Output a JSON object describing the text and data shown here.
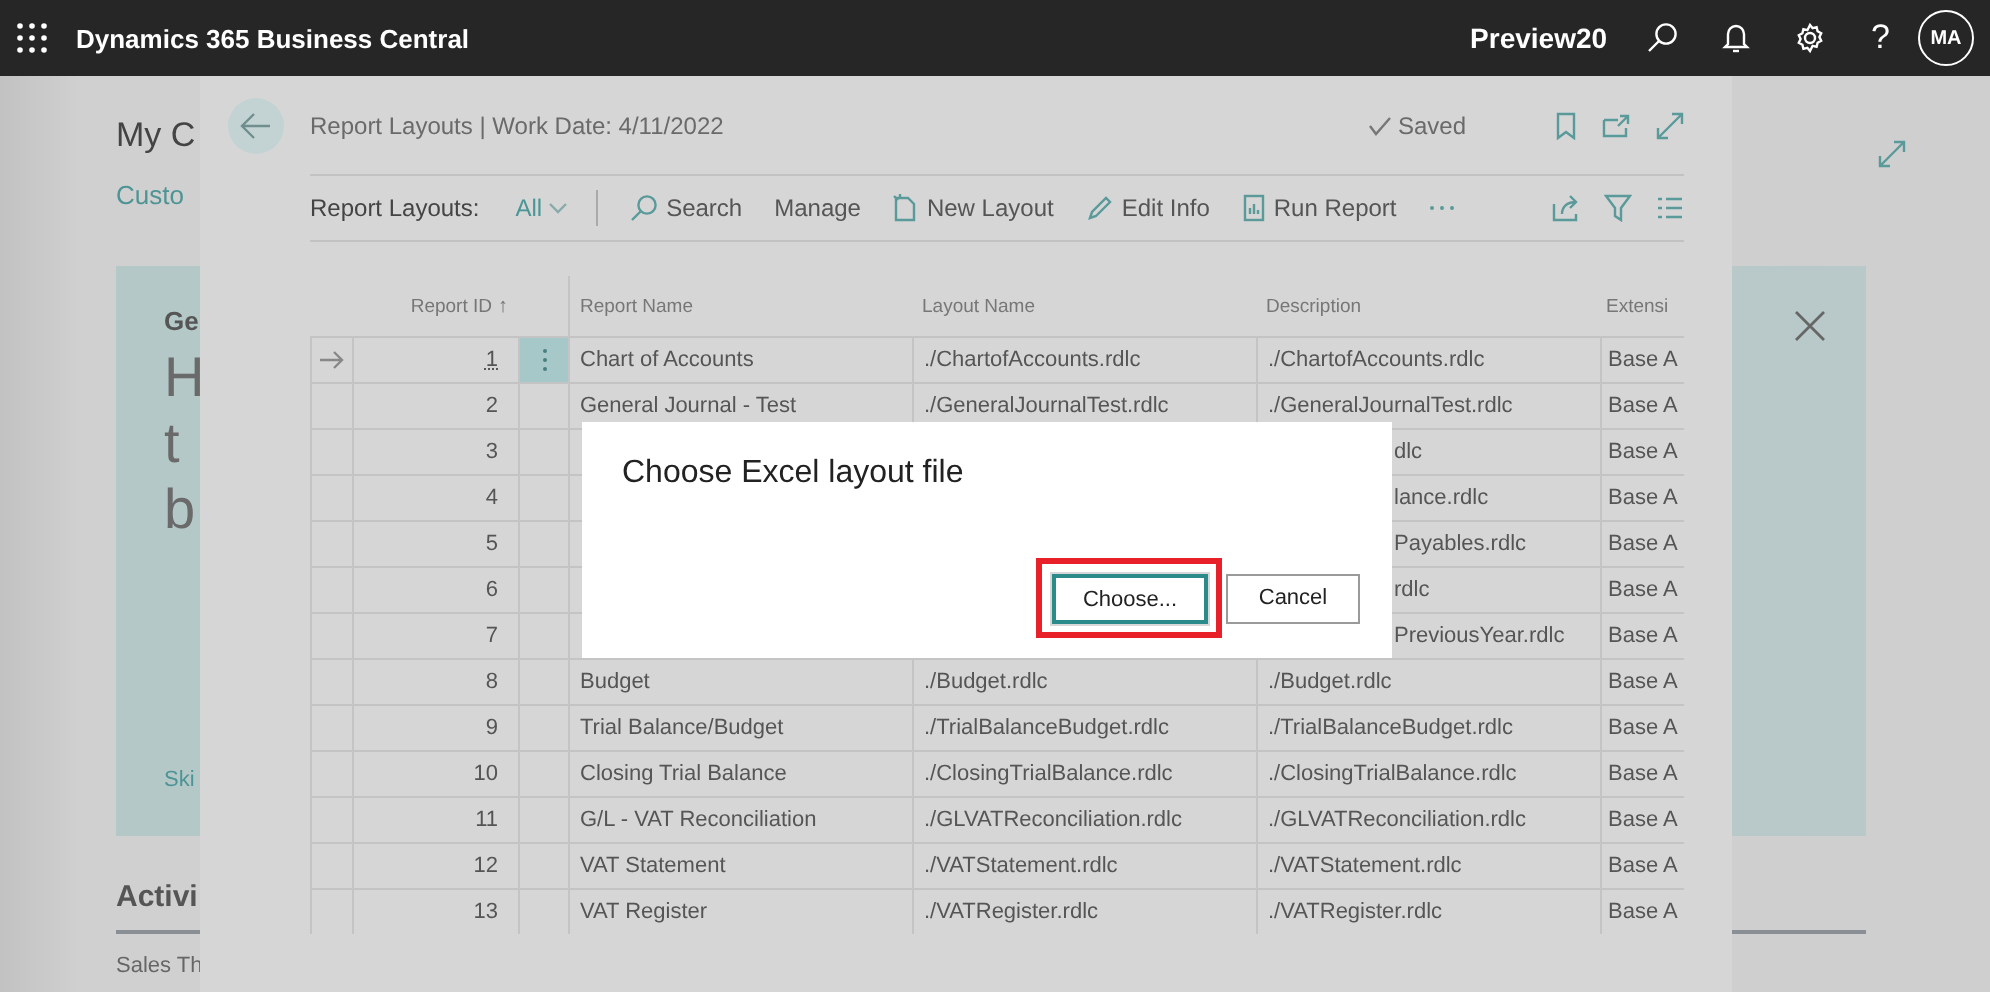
{
  "top_bar": {
    "app_title": "Dynamics 365 Business Central",
    "environment": "Preview20",
    "help": "?",
    "avatar": "MA"
  },
  "background_page": {
    "title": "My C",
    "link": "Custo",
    "card": {
      "heading": "Ge",
      "lines": [
        "H",
        "t",
        "b"
      ],
      "link": "Ski"
    },
    "section": "Activi",
    "subsection": "Sales Th"
  },
  "panel": {
    "title": "Report Layouts | Work Date: 4/11/2022",
    "status": "Saved",
    "filter_label": "Report Layouts:",
    "filter_value": "All",
    "actions": [
      {
        "label": "Search",
        "kind": "search"
      },
      {
        "label": "Manage",
        "kind": "plain"
      },
      {
        "label": "New Layout",
        "kind": "new"
      },
      {
        "label": "Edit Info",
        "kind": "edit"
      },
      {
        "label": "Run Report",
        "kind": "report"
      }
    ],
    "table": {
      "columns": [
        {
          "label": "Report ID",
          "sort_indicator": "↑"
        },
        {
          "label": "Report Name"
        },
        {
          "label": "Layout Name"
        },
        {
          "label": "Description"
        },
        {
          "label": "Extensi"
        }
      ],
      "rows": [
        {
          "id": "1",
          "name": "Chart of Accounts",
          "layout": "./ChartofAccounts.rdlc",
          "description": "./ChartofAccounts.rdlc",
          "covered": false,
          "extension": "Base A",
          "selected": true
        },
        {
          "id": "2",
          "name": "General Journal - Test",
          "layout": "./GeneralJournalTest.rdlc",
          "description": "./GeneralJournalTest.rdlc",
          "covered": false,
          "extension": "Base A",
          "selected": false
        },
        {
          "id": "3",
          "description": "dlc",
          "covered": true,
          "extension": "Base A",
          "selected": false
        },
        {
          "id": "4",
          "description": "lance.rdlc",
          "covered": true,
          "extension": "Base A",
          "selected": false
        },
        {
          "id": "5",
          "description": "Payables.rdlc",
          "covered": true,
          "extension": "Base A",
          "selected": false
        },
        {
          "id": "6",
          "description": "rdlc",
          "covered": true,
          "extension": "Base A",
          "selected": false
        },
        {
          "id": "7",
          "description": "PreviousYear.rdlc",
          "covered": true,
          "extension": "Base A",
          "selected": false
        },
        {
          "id": "8",
          "name": "Budget",
          "layout": "./Budget.rdlc",
          "description": "./Budget.rdlc",
          "covered": false,
          "extension": "Base A",
          "selected": false
        },
        {
          "id": "9",
          "name": "Trial Balance/Budget",
          "layout": "./TrialBalanceBudget.rdlc",
          "description": "./TrialBalanceBudget.rdlc",
          "covered": false,
          "extension": "Base A",
          "selected": false
        },
        {
          "id": "10",
          "name": "Closing Trial Balance",
          "layout": "./ClosingTrialBalance.rdlc",
          "description": "./ClosingTrialBalance.rdlc",
          "covered": false,
          "extension": "Base A",
          "selected": false
        },
        {
          "id": "11",
          "name": "G/L - VAT Reconciliation",
          "layout": "./GLVATReconciliation.rdlc",
          "description": "./GLVATReconciliation.rdlc",
          "covered": false,
          "extension": "Base A",
          "selected": false
        },
        {
          "id": "12",
          "name": "VAT Statement",
          "layout": "./VATStatement.rdlc",
          "description": "./VATStatement.rdlc",
          "covered": false,
          "extension": "Base A",
          "selected": false
        },
        {
          "id": "13",
          "name": "VAT Register",
          "layout": "./VATRegister.rdlc",
          "description": "./VATRegister.rdlc",
          "covered": false,
          "extension": "Base A",
          "selected": false
        }
      ]
    }
  },
  "dialog": {
    "title": "Choose Excel layout file",
    "buttons": [
      {
        "label": "Choose...",
        "focused": true,
        "highlighted": true
      },
      {
        "label": "Cancel",
        "focused": false,
        "highlighted": false
      }
    ]
  }
}
